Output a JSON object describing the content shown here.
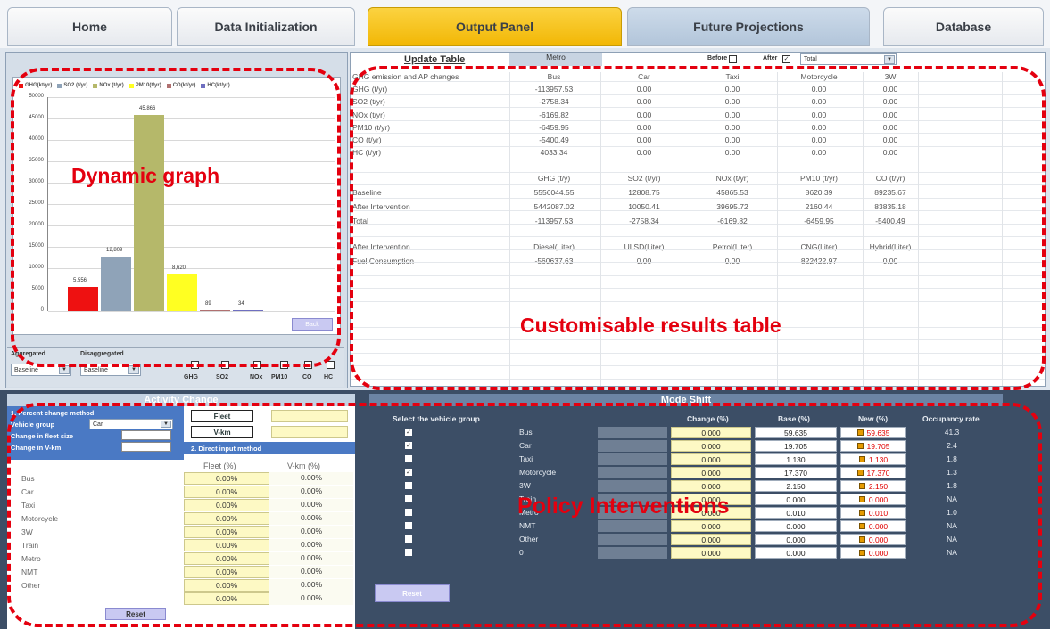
{
  "tabs": [
    {
      "label": "Home"
    },
    {
      "label": "Data Initialization"
    },
    {
      "label": "Output Panel"
    },
    {
      "label": "Future Projections"
    },
    {
      "label": "Database"
    }
  ],
  "overlays": {
    "graph": "Dynamic graph",
    "table": "Customisable results table",
    "policy": "Policy Interventions"
  },
  "table_toolbar": {
    "update": "Update Table",
    "mode": "Metro",
    "before": "Before",
    "after": "After",
    "select": "Total"
  },
  "table1": {
    "headers": [
      "GHG emission and AP changes",
      "Bus",
      "Car",
      "Taxi",
      "Motorcycle",
      "3W"
    ],
    "rows": [
      [
        "GHG (t/yr)",
        "-113957.53",
        "0.00",
        "0.00",
        "0.00",
        "0.00"
      ],
      [
        "SO2 (t/yr)",
        "-2758.34",
        "0.00",
        "0.00",
        "0.00",
        "0.00"
      ],
      [
        "NOx (t/yr)",
        "-6169.82",
        "0.00",
        "0.00",
        "0.00",
        "0.00"
      ],
      [
        "PM10 (t/yr)",
        "-6459.95",
        "0.00",
        "0.00",
        "0.00",
        "0.00"
      ],
      [
        "CO (t/yr)",
        "-5400.49",
        "0.00",
        "0.00",
        "0.00",
        "0.00"
      ],
      [
        "HC (t/yr)",
        "4033.34",
        "0.00",
        "0.00",
        "0.00",
        "0.00"
      ]
    ]
  },
  "table2": {
    "headers": [
      "",
      "GHG (t/y)",
      "SO2 (t/yr)",
      "NOx (t/yr)",
      "PM10 (t/yr)",
      "CO (t/yr)"
    ],
    "rows": [
      [
        "Baseline",
        "5556044.55",
        "12808.75",
        "45865.53",
        "8620.39",
        "89235.67"
      ],
      [
        "After Intervention",
        "5442087.02",
        "10050.41",
        "39695.72",
        "2160.44",
        "83835.18"
      ],
      [
        "Total",
        "-113957.53",
        "-2758.34",
        "-6169.82",
        "-6459.95",
        "-5400.49"
      ]
    ]
  },
  "table3": {
    "headers": [
      "After Intervention",
      "Diesel(Liter)",
      "ULSD(Liter)",
      "Petrol(Liter)",
      "CNG(Liter)",
      "Hybrid(Liter)"
    ],
    "rows": [
      [
        "Fuel Consumption",
        "-560637.63",
        "0.00",
        "0.00",
        "822422.97",
        "0.00"
      ]
    ]
  },
  "graph": {
    "legend": [
      "GHG(kt/yr)",
      "SO2 (t/yr)",
      "NOx (t/yr)",
      "PM10(t/yr)",
      "CO(kt/yr)",
      "HC(kt/yr)"
    ],
    "button": "Back",
    "yticks": [
      "50000",
      "45000",
      "40000",
      "35000",
      "30000",
      "25000",
      "20000",
      "15000",
      "10000",
      "5000",
      "0"
    ]
  },
  "chart_data": {
    "type": "bar",
    "categories": [
      "GHG",
      "SO2",
      "NOx",
      "PM10",
      "CO",
      "HC"
    ],
    "values": [
      5556,
      12809,
      45866,
      8620,
      89,
      34
    ],
    "labels": [
      "5,556",
      "12,809",
      "45,866",
      "8,620",
      "89",
      "34"
    ],
    "colors": [
      "#ee1111",
      "#8fa3b8",
      "#b5b86a",
      "#ffff22",
      "#b07070",
      "#6f6fc0"
    ],
    "ylim": [
      0,
      50000
    ]
  },
  "controls": {
    "aggregated": "Aggregated",
    "disaggregated": "Disaggregated",
    "dd1": "Baseline",
    "dd2": "Baseline",
    "checks": [
      "GHG",
      "SO2",
      "NOx",
      "PM10",
      "CO",
      "HC"
    ]
  },
  "activity": {
    "title": "Activity Change",
    "method1": "1. Percent change method",
    "vehicle_group": "Vehicle group",
    "vehicle_value": "Car",
    "fleet_size": "Change in fleet size",
    "vkm": "Change in V-km",
    "method2": "2. Direct input method",
    "fleet_btn": "Fleet",
    "vkm_btn": "V-km",
    "col1": "Fleet (%)",
    "col2": "V-km (%)",
    "rows": [
      [
        "Bus",
        "0.00%",
        "0.00%"
      ],
      [
        "Car",
        "0.00%",
        "0.00%"
      ],
      [
        "Taxi",
        "0.00%",
        "0.00%"
      ],
      [
        "Motorcycle",
        "0.00%",
        "0.00%"
      ],
      [
        "3W",
        "0.00%",
        "0.00%"
      ],
      [
        "Train",
        "0.00%",
        "0.00%"
      ],
      [
        "Metro",
        "0.00%",
        "0.00%"
      ],
      [
        "NMT",
        "0.00%",
        "0.00%"
      ],
      [
        "Other",
        "0.00%",
        "0.00%"
      ],
      [
        "",
        "0.00%",
        "0.00%"
      ]
    ],
    "reset": "Reset"
  },
  "mode": {
    "title": "Mode Shift",
    "select_label": "Select the vehicle group",
    "headers": [
      "Change (%)",
      "Base (%)",
      "New (%)",
      "Occupancy rate"
    ],
    "rows": [
      {
        "checked": true,
        "name": "Bus",
        "change": "0.000",
        "base": "59.635",
        "new": "59.635",
        "occ": "41.3"
      },
      {
        "checked": true,
        "name": "Car",
        "change": "0.000",
        "base": "19.705",
        "new": "19.705",
        "occ": "2.4"
      },
      {
        "checked": false,
        "name": "Taxi",
        "change": "0.000",
        "base": "1.130",
        "new": "1.130",
        "occ": "1.8"
      },
      {
        "checked": true,
        "name": "Motorcycle",
        "change": "0.000",
        "base": "17.370",
        "new": "17.370",
        "occ": "1.3"
      },
      {
        "checked": false,
        "name": "3W",
        "change": "0.000",
        "base": "2.150",
        "new": "2.150",
        "occ": "1.8"
      },
      {
        "checked": false,
        "name": "Train",
        "change": "0.000",
        "base": "0.000",
        "new": "0.000",
        "occ": "NA"
      },
      {
        "checked": false,
        "name": "Metro",
        "change": "0.000",
        "base": "0.010",
        "new": "0.010",
        "occ": "1.0"
      },
      {
        "checked": false,
        "name": "NMT",
        "change": "0.000",
        "base": "0.000",
        "new": "0.000",
        "occ": "NA"
      },
      {
        "checked": false,
        "name": "Other",
        "change": "0.000",
        "base": "0.000",
        "new": "0.000",
        "occ": "NA"
      },
      {
        "checked": false,
        "name": "0",
        "change": "0.000",
        "base": "0.000",
        "new": "0.000",
        "occ": "NA"
      }
    ],
    "reset": "Reset"
  }
}
